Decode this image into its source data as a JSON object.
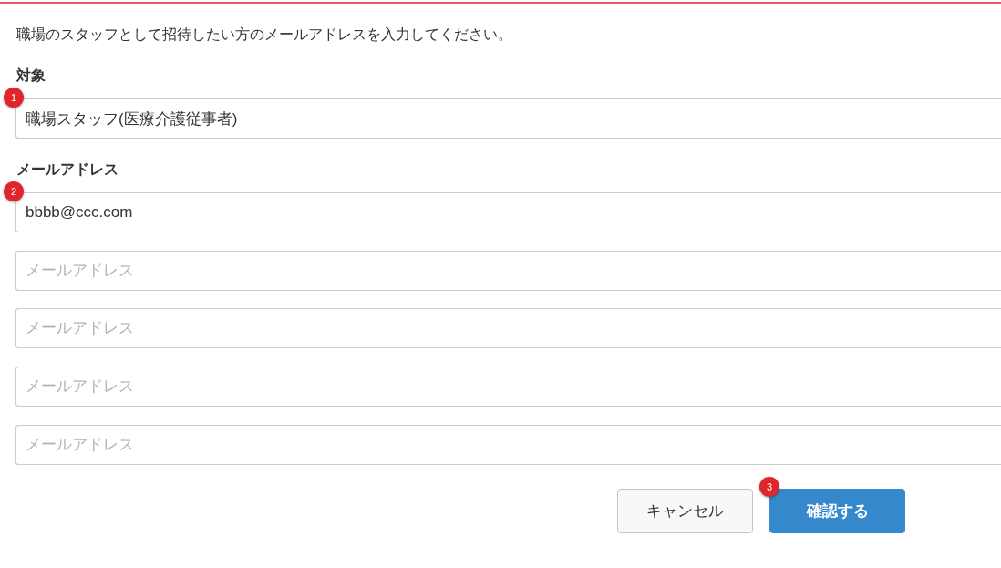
{
  "instruction": "職場のスタッフとして招待したい方のメールアドレスを入力してください。",
  "target": {
    "label": "対象",
    "value": "職場スタッフ(医療介護従事者)",
    "marker": "1"
  },
  "email": {
    "label": "メールアドレス",
    "marker": "2",
    "fields": [
      {
        "value": "bbbb@ccc.com"
      },
      {
        "placeholder": "メールアドレス"
      },
      {
        "placeholder": "メールアドレス"
      },
      {
        "placeholder": "メールアドレス"
      },
      {
        "placeholder": "メールアドレス"
      }
    ]
  },
  "buttons": [
    {
      "kind": "secondary",
      "label": "キャンセル"
    },
    {
      "kind": "primary",
      "label": "確認する",
      "marker": "3"
    }
  ]
}
